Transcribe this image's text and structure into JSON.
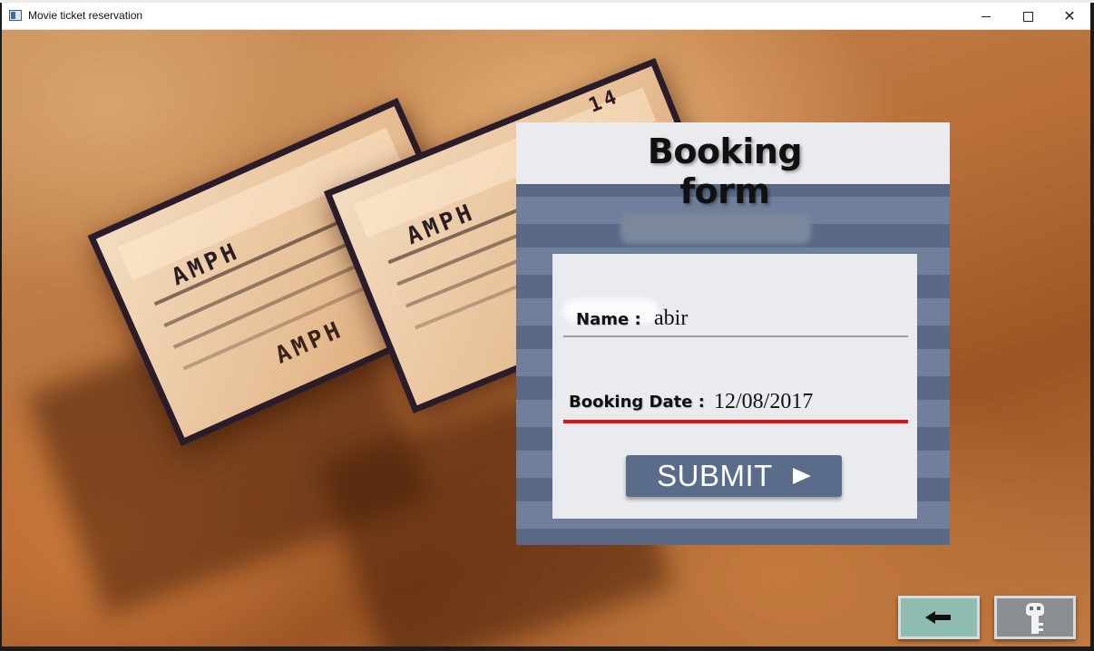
{
  "window": {
    "title": "Movie ticket reservation",
    "controls": [
      "minimize",
      "maximize",
      "close"
    ]
  },
  "background": {
    "tickets": [
      {
        "label": "AMPH",
        "number": "14"
      },
      {
        "label": "AMPH",
        "extra": "AMPH"
      }
    ]
  },
  "form": {
    "title": "Booking form",
    "name_label": "Name :",
    "name_value": "abir",
    "date_label": "Booking Date :",
    "date_value": "12/08/2017",
    "submit_label": "SUBMIT"
  },
  "bottom_buttons": [
    {
      "icon": "back-arrow-icon"
    },
    {
      "icon": "key-icon"
    }
  ],
  "colors": {
    "panel_stripe_dark": "#5a6a86",
    "panel_stripe_light": "#6f7f9c",
    "form_bg": "#e9ebef",
    "date_underline": "#e10f0f",
    "submit_bg": "#5a6c8a",
    "back_button_bg": "#8fbdb1",
    "key_button_bg": "#8a8e93"
  }
}
